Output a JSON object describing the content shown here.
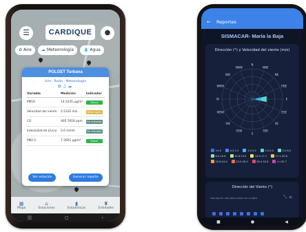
{
  "left_phone": {
    "header": {
      "logo_text": "CARDIQUE",
      "menu_icon": "menu-icon",
      "avatar_icon": "user-icon"
    },
    "chips": [
      {
        "label": "Aire",
        "icon": "air-icon"
      },
      {
        "label": "Meteorología",
        "icon": "weather-icon"
      },
      {
        "label": "Agua",
        "icon": "water-icon"
      }
    ],
    "modal": {
      "title": "POLGET Turbana",
      "subtitle": "Aire - Ruido - Meteorología",
      "columns": [
        "Variable",
        "Medición",
        "Indicador"
      ],
      "rows": [
        {
          "variable": "PM10",
          "value": "14.5235 µg/m³",
          "indicator": "Bueno",
          "color": "#2fb44a"
        },
        {
          "variable": "Velocidad del viento",
          "value": "2.5332 m/s",
          "indicator": "Brisa Ligera",
          "color": "#d9b84a"
        },
        {
          "variable": "CO",
          "value": "405.7618 ppm",
          "indicator": "Sin indicador",
          "color": "#5a8c8c"
        },
        {
          "variable": "Intensidad de Lluvia",
          "value": "0.0 mm/h",
          "indicator": "Sin indicador",
          "color": "#5a8c8c"
        },
        {
          "variable": "PM2.5",
          "value": "7.2601 µg/m³",
          "indicator": "Bueno",
          "color": "#2fb44a"
        }
      ],
      "actions": {
        "primary": "Ver estación",
        "secondary": "Generar reporte"
      }
    },
    "bottom_nav": [
      {
        "label": "Mapa",
        "icon": "map-icon"
      },
      {
        "label": "Estaciones",
        "icon": "station-icon"
      },
      {
        "label": "Estadísticas",
        "icon": "stats-icon"
      },
      {
        "label": "Entidades",
        "icon": "entities-icon"
      }
    ]
  },
  "right_phone": {
    "header": {
      "title": "Reportes",
      "back_icon": "arrow-left-icon"
    },
    "station_name": "SISMACAR- María la Baja",
    "windrose": {
      "title": "Dirección (°) y Velocidad del viento (m/s)",
      "directions": [
        "N",
        "NNE",
        "NE",
        "ENE",
        "E",
        "ESE",
        "SE",
        "SSE",
        "S",
        "SSW",
        "SW",
        "WSW",
        "W",
        "WNW",
        "NW",
        "NNW"
      ],
      "dominant_direction": "E",
      "legend": [
        {
          "label": "<0.5",
          "color": "#3f6ee8"
        },
        {
          "label": "0.5-1.5",
          "color": "#4a7ff0"
        },
        {
          "label": "1.5-3.3",
          "color": "#3bb8e6"
        },
        {
          "label": "3.3-5.5",
          "color": "#4fd7e0"
        },
        {
          "label": "5.5-8.0",
          "color": "#6ee3c4"
        },
        {
          "label": "8.0-10.8",
          "color": "#8ce89a"
        },
        {
          "label": "10.8-13.9",
          "color": "#b7ec70"
        },
        {
          "label": "13.9-17.1",
          "color": "#e0ec5a"
        },
        {
          "label": "17.1-20.8",
          "color": "#f2c94c"
        },
        {
          "label": "20.8-24.4",
          "color": "#f29a4c"
        },
        {
          "label": "24.5-28.4",
          "color": "#f06a4a"
        },
        {
          "label": "28.4-32.6",
          "color": "#e04a6a"
        },
        {
          "label": ">=32.7",
          "color": "#c04ab0"
        }
      ]
    },
    "second_card": {
      "title": "Dirección del Viento (°)",
      "hint": "Haz tap en una barra para ver el dato",
      "icons": [
        "zoom-icon",
        "menu-icon"
      ],
      "swatches": [
        "#3f6ee8",
        "#3f6ee8",
        "#3f6ee8",
        "#3f6ee8",
        "#3f6ee8",
        "#3f6ee8",
        "#3f6ee8",
        "#3f6ee8"
      ]
    }
  }
}
